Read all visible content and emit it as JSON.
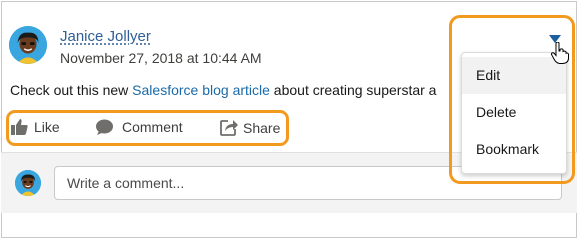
{
  "post": {
    "author": "Janice Jollyer",
    "timestamp": "November 27, 2018 at 10:44 AM",
    "text_before": "Check out this new ",
    "link_text": "Salesforce blog article",
    "text_after": " about creating superstar a"
  },
  "actions": {
    "like": "Like",
    "comment": "Comment",
    "share": "Share"
  },
  "comment_box": {
    "placeholder": "Write a comment..."
  },
  "menu": {
    "items": [
      "Edit",
      "Delete",
      "Bookmark"
    ]
  },
  "colors": {
    "highlight": "#f29a1f",
    "link": "#1a6aa8",
    "avatar_bg": "#3aa6df",
    "trigger": "#1b5f9e"
  },
  "icons": [
    "like-icon",
    "comment-icon",
    "share-icon",
    "chevron-down-icon",
    "hand-cursor-icon"
  ]
}
